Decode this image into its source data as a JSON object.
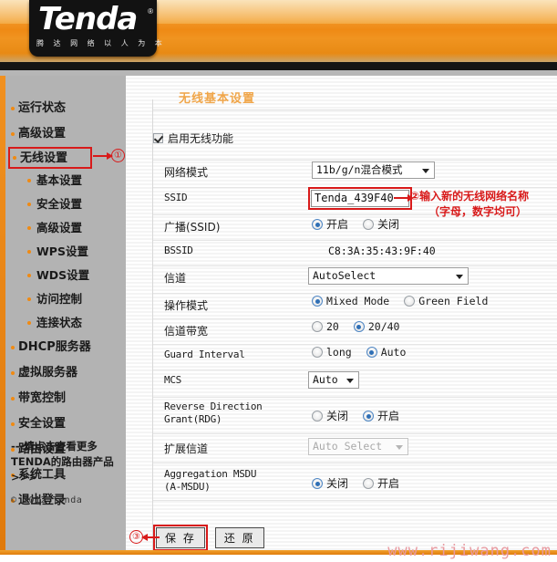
{
  "header": {
    "logo_text": "Tenda",
    "logo_registered": "®",
    "logo_subtitle": "腾 达 网 络 以 人 为 本"
  },
  "sidebar": {
    "items": [
      {
        "label": "运行状态",
        "level": 1,
        "highlighted": false
      },
      {
        "label": "高级设置",
        "level": 1,
        "highlighted": false
      },
      {
        "label": "无线设置",
        "level": 1,
        "highlighted": true
      },
      {
        "label": "基本设置",
        "level": 2,
        "highlighted": false
      },
      {
        "label": "安全设置",
        "level": 2,
        "highlighted": false
      },
      {
        "label": "高级设置",
        "level": 2,
        "highlighted": false
      },
      {
        "label": "WPS设置",
        "level": 2,
        "highlighted": false
      },
      {
        "label": "WDS设置",
        "level": 2,
        "highlighted": false
      },
      {
        "label": "访问控制",
        "level": 2,
        "highlighted": false
      },
      {
        "label": "连接状态",
        "level": 2,
        "highlighted": false
      },
      {
        "label": "DHCP服务器",
        "level": 1,
        "highlighted": false
      },
      {
        "label": "虚拟服务器",
        "level": 1,
        "highlighted": false
      },
      {
        "label": "带宽控制",
        "level": 1,
        "highlighted": false
      },
      {
        "label": "安全设置",
        "level": 1,
        "highlighted": false
      },
      {
        "label": "路由设置",
        "level": 1,
        "highlighted": false
      },
      {
        "label": "系统工具",
        "level": 1,
        "highlighted": false
      },
      {
        "label": "退出登录",
        "level": 1,
        "highlighted": false
      }
    ],
    "promo_line1": "---请点击查看更多",
    "promo_line2": "TENDA的路由器产品",
    "promo_line3": ">>>",
    "copyright": "© 2012 Tenda"
  },
  "main": {
    "page_title": "无线基本设置",
    "enable_wireless": {
      "label": "启用无线功能",
      "checked": true
    },
    "rows": {
      "network_mode": {
        "label": "网络模式",
        "value": "11b/g/n混合模式"
      },
      "ssid": {
        "label": "SSID",
        "value": "Tenda_439F40"
      },
      "broadcast_ssid": {
        "label": "广播(SSID)",
        "options": [
          "开启",
          "关闭"
        ],
        "selected": "开启"
      },
      "bssid": {
        "label": "BSSID",
        "value": "C8:3A:35:43:9F:40"
      },
      "channel": {
        "label": "信道",
        "value": "AutoSelect"
      },
      "operating_mode": {
        "label": "操作模式",
        "options": [
          "Mixed Mode",
          "Green Field"
        ],
        "selected": "Mixed Mode"
      },
      "channel_bandwidth": {
        "label": "信道带宽",
        "options": [
          "20",
          "20/40"
        ],
        "selected": "20/40"
      },
      "guard_interval": {
        "label": "Guard Interval",
        "options": [
          "long",
          "Auto"
        ],
        "selected": "Auto"
      },
      "mcs": {
        "label": "MCS",
        "value": "Auto"
      },
      "rdg": {
        "label_line1": "Reverse Direction",
        "label_line2": "Grant(RDG)",
        "options": [
          "关闭",
          "开启"
        ],
        "selected": "开启"
      },
      "extension_channel": {
        "label": "扩展信道",
        "value": "Auto Select",
        "disabled": true
      },
      "amsdu": {
        "label_line1": "Aggregation MSDU",
        "label_line2": "(A-MSDU)",
        "options": [
          "关闭",
          "开启"
        ],
        "selected": "关闭"
      }
    },
    "buttons": {
      "save": "保 存",
      "restore": "还 原"
    }
  },
  "annotations": {
    "step1": {
      "number": "①"
    },
    "step2": {
      "number": "②",
      "text_line1": "②输入新的无线网络名称",
      "text_line2": "（字母，数字均可）"
    },
    "step3": {
      "number": "③"
    }
  },
  "watermark": "www.rijiwang.com",
  "colors": {
    "brand_orange": "#ef8a15",
    "annotation_red": "#d81a1a",
    "sidebar_gray": "#b3b3b3",
    "title_orange": "#f0a64a",
    "radio_blue": "#2f6fb5",
    "watermark_pink": "#e89aa0"
  }
}
